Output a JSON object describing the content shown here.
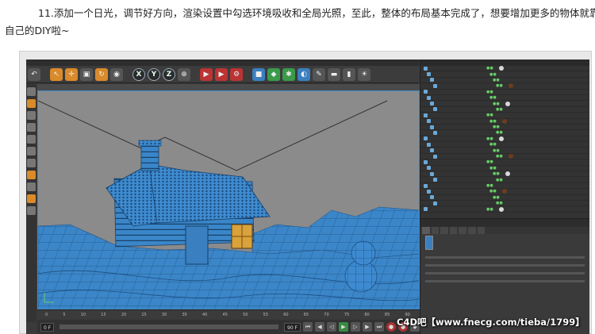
{
  "caption": {
    "line1": "11.添加一个日光，调节好方向，渲染设置中勾选环境吸收和全局光照，至此，整体的布局基本完成了，想要增加更多的物体就靠",
    "line2": "自己的DIY啦~"
  },
  "toolbar": {
    "axis_x": "X",
    "axis_y": "Y",
    "axis_z": "Z"
  },
  "timeline": {
    "ticks": [
      "0",
      "5",
      "10",
      "15",
      "20",
      "25",
      "30",
      "35",
      "40",
      "45",
      "50",
      "55",
      "60",
      "65",
      "70",
      "75",
      "80",
      "85",
      "90"
    ]
  },
  "playbar": {
    "start_field": "0 F",
    "end_field": "90 F"
  },
  "watermark": "C4D吧【www.fnecg.com/tieba/1799】",
  "colors": {
    "mesh_blue": "#3b86c8",
    "viewport_bg": "#8c8c8c",
    "window_glow": "#d9a23a"
  }
}
